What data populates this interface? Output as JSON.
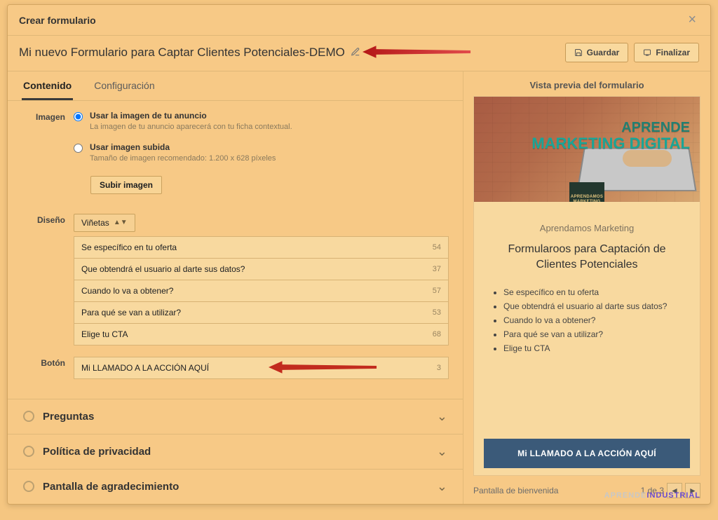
{
  "modal": {
    "title": "Crear formulario"
  },
  "header": {
    "form_title": "Mi nuevo Formulario para Captar Clientes Potenciales-DEMO",
    "save_label": "Guardar",
    "finish_label": "Finalizar"
  },
  "tabs": {
    "content": "Contenido",
    "settings": "Configuración"
  },
  "image_section": {
    "label": "Imagen",
    "opt_ad": "Usar la imagen de tu anuncio",
    "opt_ad_hint": "La imagen de tu anuncio aparecerá con tu ficha contextual.",
    "opt_upload": "Usar imagen subida",
    "opt_upload_hint": "Tamaño de imagen recomendado: 1.200 x 628 píxeles",
    "upload_button": "Subir imagen"
  },
  "design_section": {
    "label": "Diseño",
    "select_value": "Viñetas",
    "bullets": [
      {
        "text": "Se específico en tu oferta",
        "remaining": "54"
      },
      {
        "text": "Que obtendrá el usuario al darte sus datos?",
        "remaining": "37"
      },
      {
        "text": "Cuando lo va a obtener?",
        "remaining": "57"
      },
      {
        "text": "Para qué se van a utilizar?",
        "remaining": "53"
      },
      {
        "text": "Elige tu CTA",
        "remaining": "68"
      }
    ]
  },
  "button_section": {
    "label": "Botón",
    "value": "Mi LLAMADO A LA ACCIÓN AQUÍ",
    "remaining": "3"
  },
  "accordions": {
    "questions": "Preguntas",
    "privacy": "Política de privacidad",
    "thanks": "Pantalla de agradecimiento"
  },
  "preview": {
    "title": "Vista previa del formulario",
    "hero_line1": "APRENDE",
    "hero_line2": "MARKETING DIGITAL",
    "logo_text": "APRENDAMOS MARKETING",
    "brand": "Aprendamos Marketing",
    "headline": "Formularoos para Captación de Clientes Potenciales",
    "cta": "Mi LLAMADO A LA ACCIÓN AQUÍ",
    "footer_left": "Pantalla de bienvenida",
    "pager": "1 de 3"
  },
  "watermark": {
    "a": "APRENDE",
    "b": "INDUSTRIAL"
  }
}
